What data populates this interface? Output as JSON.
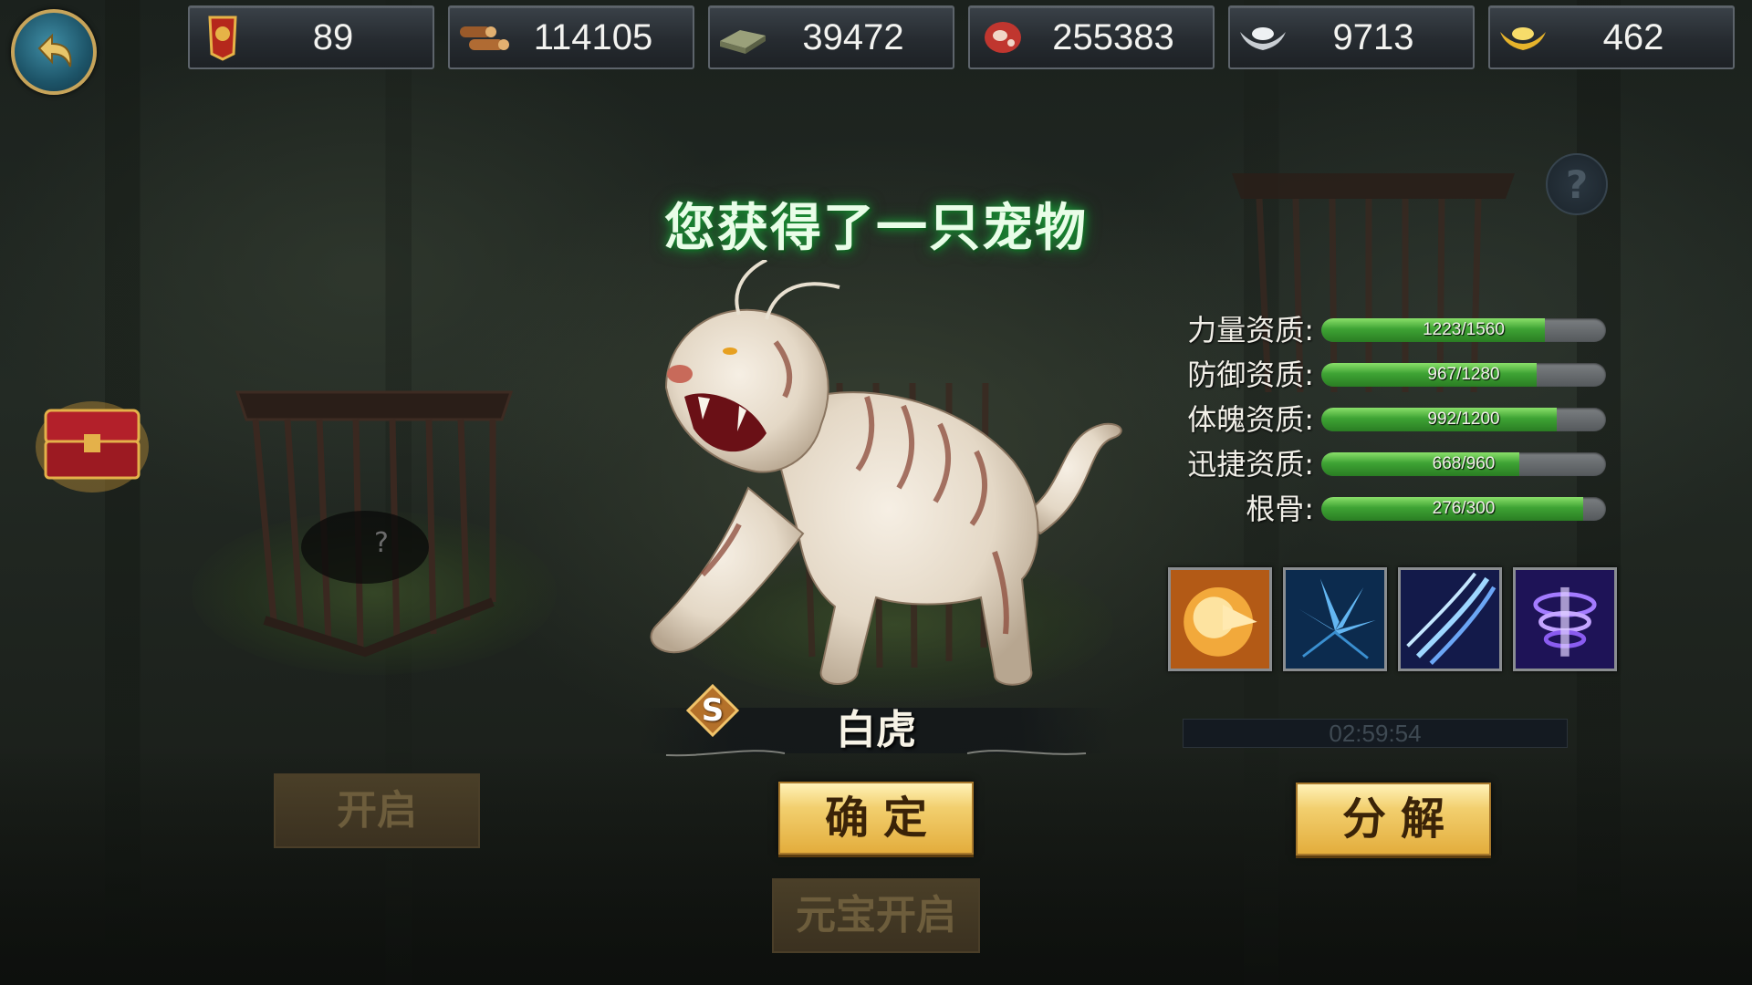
{
  "resources": [
    {
      "icon": "token-icon",
      "value": "89"
    },
    {
      "icon": "wood-icon",
      "value": "114105"
    },
    {
      "icon": "stone-icon",
      "value": "39472"
    },
    {
      "icon": "meat-icon",
      "value": "255383"
    },
    {
      "icon": "silver-icon",
      "value": "9713"
    },
    {
      "icon": "gold-ingot-icon",
      "value": "462"
    }
  ],
  "title": "您获得了一只宠物",
  "pet": {
    "name": "白虎",
    "rank": "S"
  },
  "stats": [
    {
      "label": "力量资质:",
      "text": "1223/1560",
      "ratio": 0.784
    },
    {
      "label": "防御资质:",
      "text": "967/1280",
      "ratio": 0.755
    },
    {
      "label": "体魄资质:",
      "text": "992/1200",
      "ratio": 0.827
    },
    {
      "label": "迅捷资质:",
      "text": "668/960",
      "ratio": 0.696
    },
    {
      "label": "根骨:",
      "text": "276/300",
      "ratio": 0.92
    }
  ],
  "skills": [
    "golden-tiger-skill-icon",
    "ice-shatter-skill-icon",
    "claw-slash-skill-icon",
    "purple-vortex-skill-icon"
  ],
  "timer": "02:59:54",
  "buttons": {
    "open": "开启",
    "confirm": "确定",
    "yuanbao_open": "元宝开启",
    "decompose": "分解"
  },
  "colors": {
    "bar_fill": "#3ea334",
    "gold_button": "#e3ad3d",
    "title_glow": "#1e9a3a"
  }
}
